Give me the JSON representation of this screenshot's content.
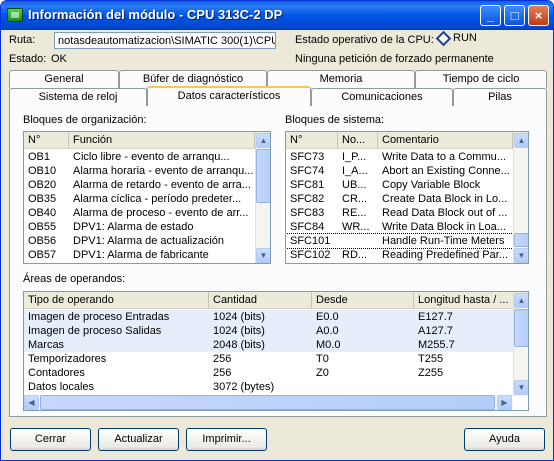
{
  "window": {
    "title": "Información del módulo - CPU 313C-2 DP",
    "controls": [
      "_",
      "□",
      "×"
    ]
  },
  "info": {
    "ruta_label": "Ruta:",
    "ruta_value": "notasdeautomatizacion\\SIMATIC 300(1)\\CPU",
    "estado_label": "Estado:",
    "estado_value": "OK",
    "op_label": "Estado operativo de la CPU:",
    "op_value": "RUN",
    "forzado": "Ninguna petición de forzado permanente"
  },
  "tabs_back": [
    "General",
    "Búfer de diagnóstico",
    "Memoria",
    "Tiempo de ciclo"
  ],
  "tabs_front": [
    "Sistema de reloj",
    "Datos característicos",
    "Comunicaciones",
    "Pilas"
  ],
  "active_tab": "Datos característicos",
  "ob_section": {
    "label": "Bloques de organización:",
    "columns": [
      "N°",
      "Función"
    ],
    "rows": [
      [
        "OB1",
        "Ciclo libre        - evento de arranqu..."
      ],
      [
        "OB10",
        "Alarma horaria - evento de arranqu..."
      ],
      [
        "OB20",
        "Alarma de retardo - evento de arra..."
      ],
      [
        "OB35",
        "Alarma cíclica  - período predeter..."
      ],
      [
        "OB40",
        "Alarma de proceso - evento de arr..."
      ],
      [
        "OB55",
        "DPV1: Alarma de estado"
      ],
      [
        "OB56",
        "DPV1: Alarma de actualización"
      ],
      [
        "OB57",
        "DPV1: Alarma de fabricante"
      ]
    ]
  },
  "sfc_section": {
    "label": "Bloques de sistema:",
    "columns": [
      "N°",
      "No...",
      "Comentario"
    ],
    "rows": [
      [
        "SFC73",
        "I_P...",
        "Write Data to a Commu..."
      ],
      [
        "SFC74",
        "I_A...",
        "Abort an Existing Conne..."
      ],
      [
        "SFC81",
        "UB...",
        "Copy Variable Block"
      ],
      [
        "SFC82",
        "CR...",
        "Create Data Block in Lo..."
      ],
      [
        "SFC83",
        "RE...",
        "Read Data Block out of ..."
      ],
      [
        "SFC84",
        "WR...",
        "Write Data Block in Loa..."
      ],
      [
        "SFC101",
        "",
        "Handle Run-Time Meters"
      ],
      [
        "SFC102",
        "RD...",
        "Reading Predefined Par..."
      ]
    ]
  },
  "areas_section": {
    "label": "Áreas de operandos:",
    "columns": [
      "Tipo de operando",
      "Cantidad",
      "Desde",
      "Longitud hasta / ..."
    ],
    "rows": [
      [
        "Imagen de proceso Entradas",
        "1024 (bits)",
        "E0.0",
        "E127.7"
      ],
      [
        "Imagen de proceso Salidas",
        "1024 (bits)",
        "A0.0",
        "A127.7"
      ],
      [
        "Marcas",
        "2048 (bits)",
        "M0.0",
        "M255.7"
      ],
      [
        "Temporizadores",
        "256",
        "T0",
        "T255"
      ],
      [
        "Contadores",
        "256",
        "Z0",
        "Z255"
      ],
      [
        "Datos locales",
        "3072 (bytes)",
        "",
        ""
      ]
    ]
  },
  "buttons": {
    "cerrar": "Cerrar",
    "actualizar": "Actualizar",
    "imprimir": "Imprimir...",
    "ayuda": "Ayuda"
  }
}
